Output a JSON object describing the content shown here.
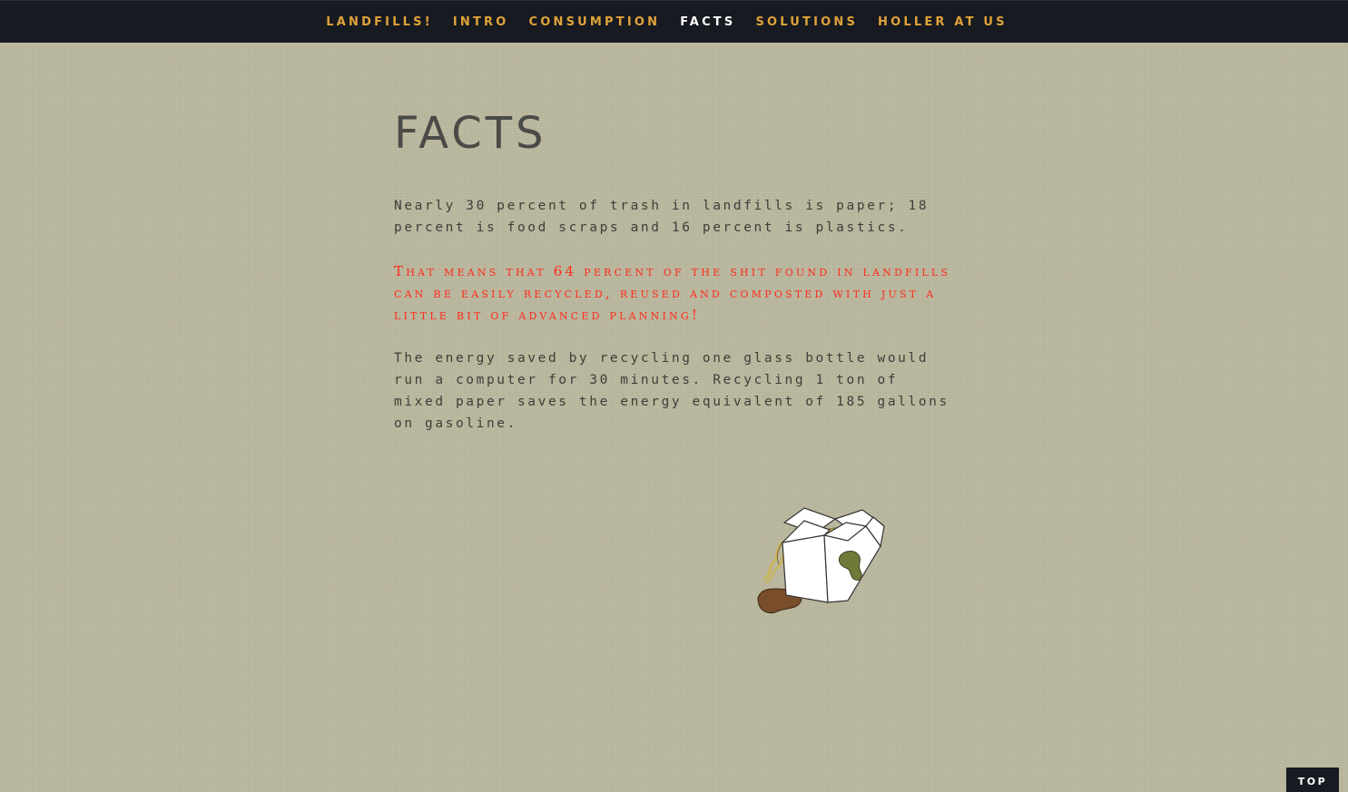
{
  "nav": {
    "items": [
      {
        "label": "LANDFILLS!",
        "active": false
      },
      {
        "label": "INTRO",
        "active": false
      },
      {
        "label": "CONSUMPTION",
        "active": false
      },
      {
        "label": "FACTS",
        "active": true
      },
      {
        "label": "SOLUTIONS",
        "active": false
      },
      {
        "label": "HOLLER AT US",
        "active": false
      }
    ]
  },
  "main": {
    "title": "FACTS",
    "facts": [
      "Nearly 30 percent of trash in landfills is paper; 18 percent is food scraps and 16 percent is plastics.",
      "That means that 64 percent of the shit found in landfills can be easily recycled, reused and composted with just a little bit of advanced planning!",
      "The energy saved by recycling one glass bottle would run a computer for 30 minutes. Recycling 1 ton of mixed paper saves the energy equivalent of 185 gallons on gasoline."
    ]
  },
  "footer": {
    "top_label": "TOP"
  },
  "colors": {
    "background": "#bbb89f",
    "navbar": "#171a20",
    "nav_link": "#e0a33a",
    "nav_active": "#ffffff",
    "text": "#3e3e3a",
    "highlight": "#ff2a1a"
  },
  "icons": {
    "illustration": "takeout-box-icon"
  }
}
